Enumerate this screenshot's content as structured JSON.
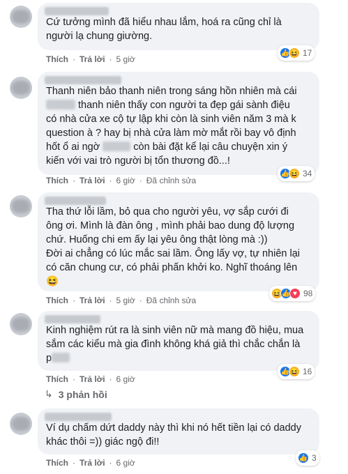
{
  "comments": [
    {
      "text": "Cứ tưởng mình đã hiểu nhau lắm, hoá ra cũng chỉ là\nngười lạ chung giường.",
      "reaction_count": "17",
      "reactions": [
        "like-icon",
        "haha-icon"
      ],
      "like": "Thích",
      "reply": "Trả lời",
      "time": "5 giờ",
      "edited": ""
    },
    {
      "text_parts": [
        "Thanh niên bảo thanh niên trong sáng hồn nhiên mà cái\n",
        " thanh niên thấy con người ta đẹp gái sành điệu\ncó nhà cửa xe cộ tự lập khi còn là sinh viên năm 3 mà k\nquestion à ? hay bị nhà cửa làm mờ mắt rồi bay vô định\nhốt ổ ai ngờ ",
        " còn bài đặt kể lại câu chuyện xin ý\nkiến với vai trò người bị tổn thương đồ...!"
      ],
      "reaction_count": "34",
      "like": "Thích",
      "reply": "Trả lời",
      "time": "6 giờ",
      "edited": "Đã chỉnh sửa"
    },
    {
      "text": "Tha thứ lỗi lầm, bỏ qua cho người yêu, vợ sắp cưới đi\nông ơi. Mình là đàn ông , mình phải bao dung độ lượng\nchứ. Huống chi em ấy lại yêu ông thật lòng mà :))\nĐời ai chẳng có lúc mắc sai lầm. Ông lấy vợ, tự nhiên lại\ncó căn chung cư, có phải phấn khởi ko. Nghĩ thoáng lên",
      "emoji": "😆",
      "reaction_count": "98",
      "like": "Thích",
      "reply": "Trả lời",
      "time": "5 giờ",
      "edited": "Đã chỉnh sửa"
    },
    {
      "text": "Kinh nghiệm rút ra là sinh viên nữ mà mang đồ hiệu, mua\nsắm các kiểu mà gia đình không khá giả thì chắc chắn là\np",
      "reaction_count": "16",
      "like": "Thích",
      "reply": "Trả lời",
      "time": "6 giờ",
      "edited": ""
    },
    {
      "text": "Ví dụ chấm dứt daddy này thì khi nó hết tiền lại có daddy\nkhác thôi =)) giác ngộ đi!!",
      "reaction_count": "3",
      "like": "Thích",
      "reply": "Trả lời",
      "time": "6 giờ",
      "edited": ""
    }
  ],
  "replies_link": "3 phản hồi",
  "sep": "·"
}
